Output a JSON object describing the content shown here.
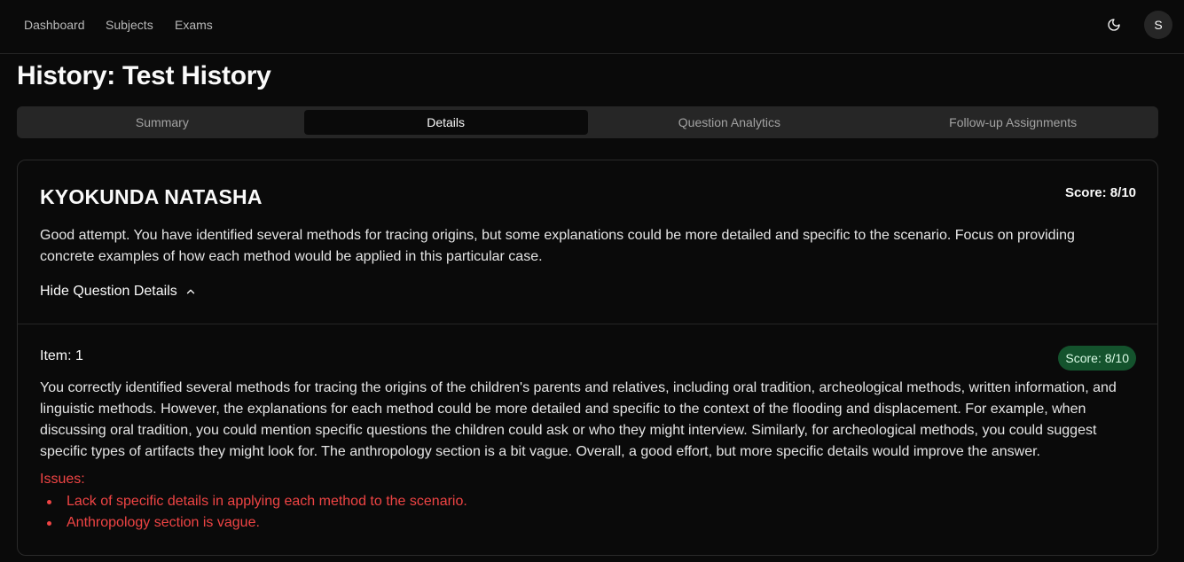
{
  "nav": {
    "dashboard": "Dashboard",
    "subjects": "Subjects",
    "exams": "Exams",
    "avatar_initial": "S",
    "theme_icon": "moon-icon"
  },
  "page": {
    "title": "History: Test History"
  },
  "tabs": [
    {
      "label": "Summary",
      "active": false
    },
    {
      "label": "Details",
      "active": true
    },
    {
      "label": "Question Analytics",
      "active": false
    },
    {
      "label": "Follow-up Assignments",
      "active": false
    }
  ],
  "student": {
    "name": "KYOKUNDA NATASHA",
    "score": "Score: 8/10",
    "feedback": "Good attempt. You have identified several methods for tracing origins, but some explanations could be more detailed and specific to the scenario. Focus on providing concrete examples of how each method would be applied in this particular case.",
    "toggle_label": "Hide Question Details"
  },
  "items": [
    {
      "label": "Item: 1",
      "score": "Score: 8/10",
      "feedback": "You correctly identified several methods for tracing the origins of the children's parents and relatives, including oral tradition, archeological methods, written information, and linguistic methods. However, the explanations for each method could be more detailed and specific to the context of the flooding and displacement. For example, when discussing oral tradition, you could mention specific questions the children could ask or who they might interview. Similarly, for archeological methods, you could suggest specific types of artifacts they might look for. The anthropology section is a bit vague. Overall, a good effort, but more specific details would improve the answer.",
      "issues_heading": "Issues:",
      "issues": [
        "Lack of specific details in applying each method to the scenario.",
        "Anthropology section is vague."
      ]
    }
  ],
  "colors": {
    "background": "#0a0a0a",
    "badge_bg": "#14532d",
    "issue_red": "#ef4444"
  }
}
